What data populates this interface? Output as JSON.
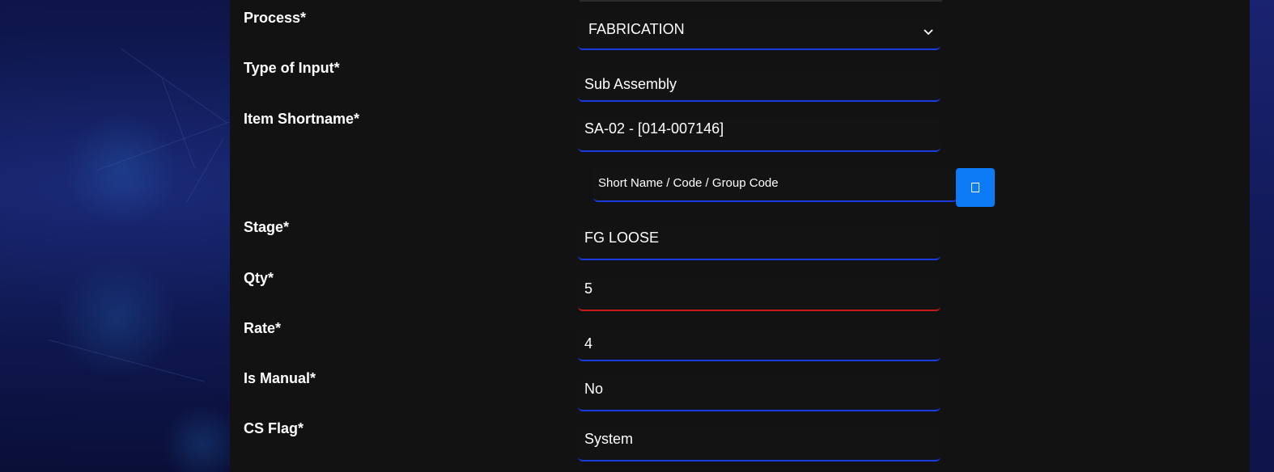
{
  "form": {
    "process": {
      "label": "Process*",
      "value": "FABRICATION"
    },
    "type_of_input": {
      "label": "Type of Input*",
      "value": "Sub Assembly"
    },
    "item_shortname": {
      "label": "Item Shortname*",
      "value": "SA-02 - [014-007146]"
    },
    "search": {
      "placeholder": "Short Name / Code / Group Code"
    },
    "stage": {
      "label": "Stage*",
      "value": "FG LOOSE"
    },
    "qty": {
      "label": "Qty*",
      "value": "5"
    },
    "rate": {
      "label": "Rate*",
      "value": "4"
    },
    "is_manual": {
      "label": "Is Manual*",
      "value": "No"
    },
    "cs_flag": {
      "label": "CS Flag*",
      "value": "System"
    }
  },
  "icons": {
    "dropdown": "chevron-down-icon",
    "search_button": "missing-glyph-icon"
  },
  "colors": {
    "panel_bg": "#121212",
    "field_underline": "#1a3be0",
    "error_underline": "#c41a1a",
    "button_bg": "#0d7bf5",
    "text": "#ffffff"
  }
}
